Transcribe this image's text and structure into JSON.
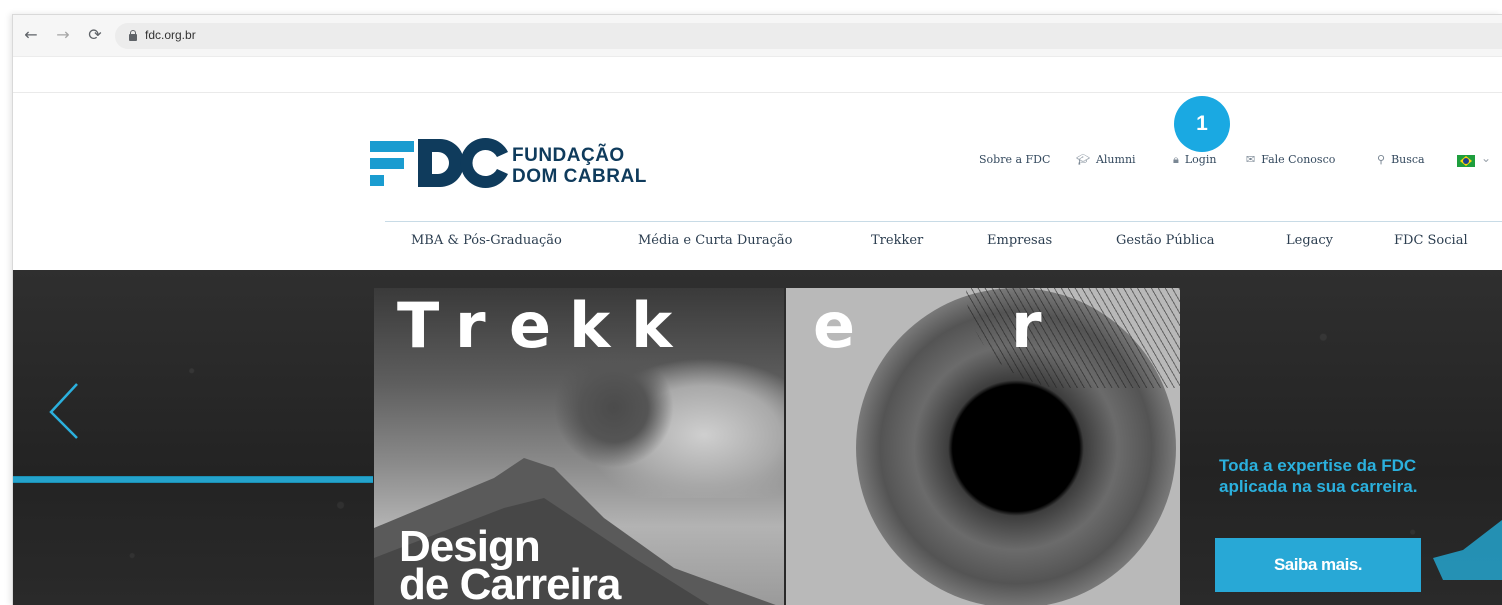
{
  "browser": {
    "back_icon": "arrow-left-icon",
    "forward_icon": "arrow-right-icon",
    "reload_icon": "reload-icon",
    "url": "fdc.org.br"
  },
  "header": {
    "logo_mark": "FDC",
    "logo_line1": "FUNDAÇÃO",
    "logo_line2": "DOM CABRAL",
    "badge": "1",
    "util_nav": [
      {
        "label": "Sobre a FDC",
        "icon": ""
      },
      {
        "label": "Alumni",
        "icon": "graduation-cap-icon"
      },
      {
        "label": "Login",
        "icon": "lock-icon"
      },
      {
        "label": "Fale Conosco",
        "icon": "envelope-icon"
      },
      {
        "label": "Busca",
        "icon": "search-icon"
      }
    ],
    "language_flag": "brazil-flag-icon"
  },
  "main_nav": [
    "MBA & Pós-Graduação",
    "Média e Curta Duração",
    "Trekker",
    "Empresas",
    "Gestão Pública",
    "Legacy",
    "FDC Social"
  ],
  "hero": {
    "word_letters": [
      "T",
      "r",
      "e",
      "k",
      "k",
      "e",
      "r"
    ],
    "title_line1": "Design",
    "title_line2": "de Carreira",
    "tagline_line1": "Toda a expertise da FDC",
    "tagline_line2": "aplicada na sua carreira.",
    "cta": "Saiba mais.",
    "colors": {
      "accent": "#28a8d6",
      "brand_dark": "#0f3b5c",
      "badge": "#1aa9e2"
    }
  }
}
